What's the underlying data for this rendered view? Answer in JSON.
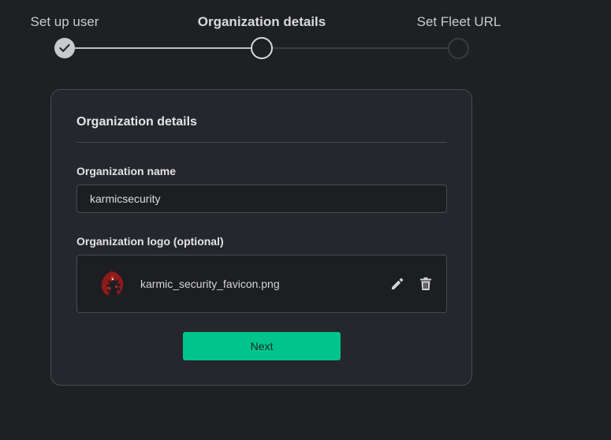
{
  "stepper": {
    "steps": [
      {
        "label": "Set up user",
        "state": "complete"
      },
      {
        "label": "Organization details",
        "state": "current"
      },
      {
        "label": "Set Fleet URL",
        "state": "pending"
      }
    ]
  },
  "form": {
    "title": "Organization details",
    "org_name": {
      "label": "Organization name",
      "value": "karmicsecurity"
    },
    "org_logo": {
      "label": "Organization logo (optional)",
      "filename": "karmic_security_favicon.png",
      "icon": "red-dragon-logo"
    },
    "actions": {
      "edit_icon": "pencil-icon",
      "delete_icon": "trash-icon"
    },
    "next_label": "Next"
  },
  "colors": {
    "background": "#1f2024",
    "card": "#26272c",
    "accent": "#00c48c"
  }
}
